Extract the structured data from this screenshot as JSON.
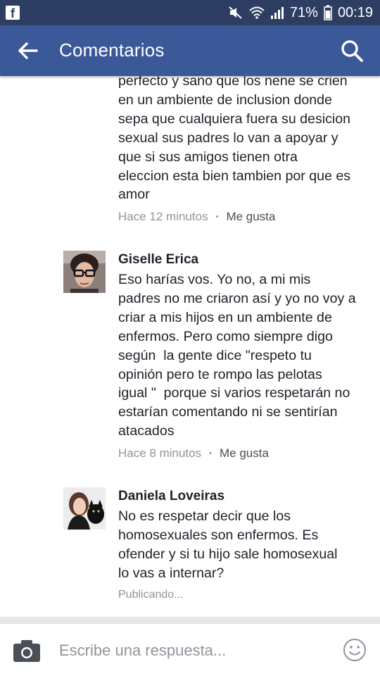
{
  "status_bar": {
    "app_icon": "f",
    "battery_percent": "71%",
    "time": "00:19",
    "icons": [
      "mute-icon",
      "wifi-icon",
      "signal-icon",
      "battery-icon"
    ]
  },
  "header": {
    "title": "Comentarios",
    "back_icon": "back-arrow-icon",
    "search_icon": "search-icon",
    "background": "#3b5998"
  },
  "comments": [
    {
      "author": "",
      "text": "perfecto y sano que los nene se crien\nen un ambiente de inclusion donde\nsepa que cualquiera fuera su desicion\nsexual sus padres lo van a apoyar y\nque si sus amigos tienen otra\neleccion esta bien tambien por que es\namor",
      "time": "Hace 12 minutos",
      "like_label": "Me gusta"
    },
    {
      "author": "Giselle Erica",
      "text": "Eso harías vos. Yo no, a mi mis\npadres no me criaron así y yo no voy a\ncriar a mis hijos en un ambiente de\nenfermos. Pero como siempre digo\nsegún  la gente dice \"respeto tu\nopinión pero te rompo las pelotas\nigual \"  porque si varios respetarán no\nestarían comentando ni se sentirían\natacados",
      "time": "Hace 8 minutos",
      "like_label": "Me gusta"
    },
    {
      "author": "Daniela Loveiras",
      "text": "No es respetar decir que los\nhomosexuales son enfermos. Es\nofender y si tu hijo sale homosexual\nlo vas a internar?",
      "status": "Publicando..."
    }
  ],
  "reply": {
    "placeholder": "Escribe una respuesta...",
    "camera_icon": "camera-icon",
    "emoji_icon": "emoji-icon"
  }
}
